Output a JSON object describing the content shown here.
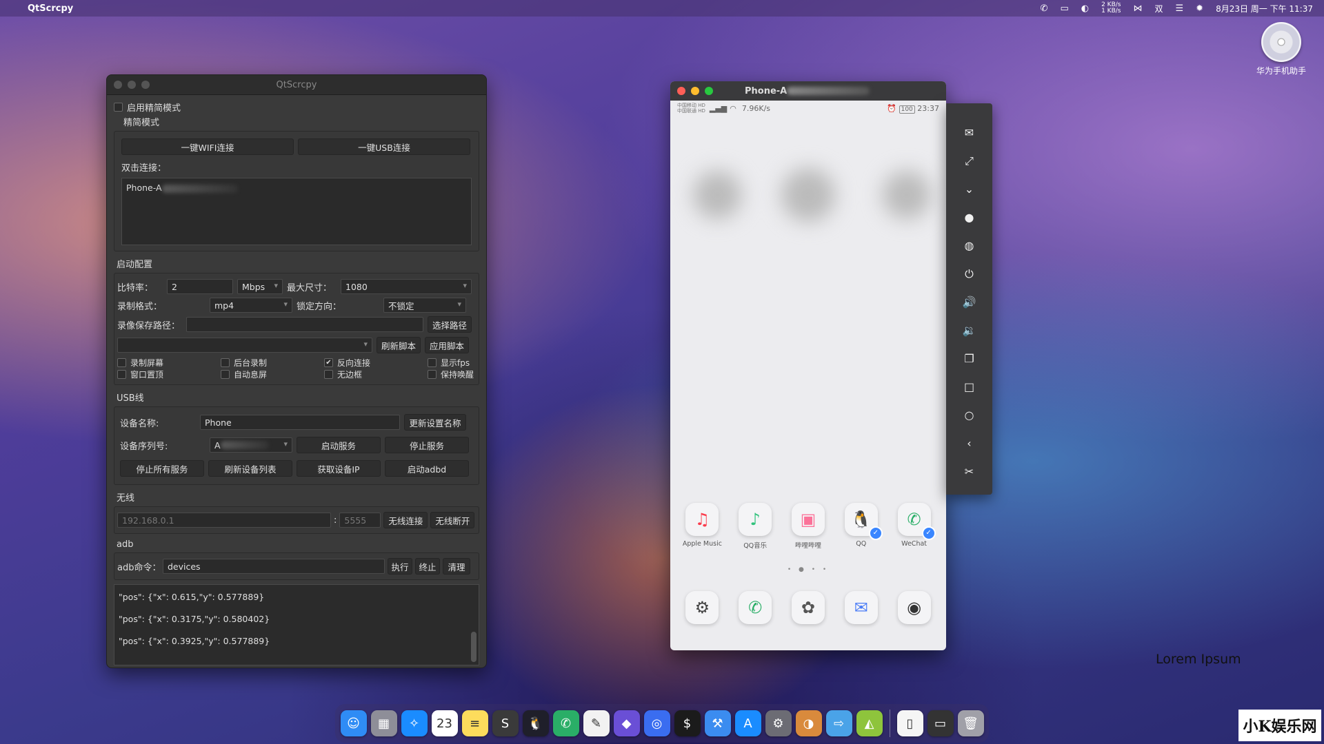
{
  "menubar": {
    "app_name": "QtScrcpy",
    "net_up": "2 KB/s",
    "net_down": "1 KB/s",
    "ime": "双",
    "datetime": "8月23日 周一 下午 11:37"
  },
  "desktop": {
    "icon_label": "华为手机助手"
  },
  "qt": {
    "title": "QtScrcpy",
    "simple_mode_checkbox": "启用精简模式",
    "simple_mode_group": "精简模式",
    "wifi_connect": "一键WIFI连接",
    "usb_connect": "一键USB连接",
    "double_click_label": "双击连接：",
    "device_list_item": "Phone-A",
    "startup_group": "启动配置",
    "bitrate_label": "比特率：",
    "bitrate_value": "2",
    "bitrate_unit": "Mbps",
    "max_size_label": "最大尺寸：",
    "max_size_value": "1080",
    "record_format_label": "录制格式：",
    "record_format_value": "mp4",
    "lock_orientation_label": "锁定方向：",
    "lock_orientation_value": "不锁定",
    "record_path_label": "录像保存路径：",
    "record_path_value": "",
    "select_path": "选择路径",
    "refresh_script": "刷新脚本",
    "apply_script": "应用脚本",
    "options": {
      "record_screen": "录制屏幕",
      "window_on_top": "窗口置顶",
      "background_record": "后台录制",
      "auto_screen_off": "自动息屏",
      "reverse_connect": "反向连接",
      "frameless": "无边框",
      "show_fps": "显示fps",
      "keep_awake": "保持唤醒"
    },
    "usb_group": "USB线",
    "device_name_label": "设备名称:",
    "device_name_value": "Phone",
    "update_name": "更新设置名称",
    "serial_label": "设备序列号:",
    "serial_value": "A",
    "start_service": "启动服务",
    "stop_service": "停止服务",
    "stop_all_services": "停止所有服务",
    "refresh_devices": "刷新设备列表",
    "get_device_ip": "获取设备IP",
    "start_adbd": "启动adbd",
    "wireless_group": "无线",
    "ip_placeholder": "192.168.0.1",
    "port_separator": ":",
    "port_placeholder": "5555",
    "wireless_connect": "无线连接",
    "wireless_disconnect": "无线断开",
    "adb_group": "adb",
    "adb_cmd_label": "adb命令：",
    "adb_cmd_value": "devices",
    "execute": "执行",
    "terminate": "终止",
    "clear": "清理",
    "log_lines": [
      "\"pos\": {\"x\": 0.615,\"y\": 0.577889}",
      "\"pos\": {\"x\": 0.3175,\"y\": 0.580402}",
      "\"pos\": {\"x\": 0.3925,\"y\": 0.577889}"
    ]
  },
  "phone": {
    "title": "Phone-A",
    "carrier1": "中国移动 HD",
    "carrier2": "中国联通 HD",
    "net_speed": "7.96K/s",
    "battery": "100",
    "time": "23:37",
    "row1": [
      {
        "name": "Apple Music",
        "icon": "music-icon",
        "glyph": "♫",
        "color": "#fa3c4c"
      },
      {
        "name": "QQ音乐",
        "icon": "qqmusic-icon",
        "glyph": "♪",
        "color": "#31c27c"
      },
      {
        "name": "哔哩哔哩",
        "icon": "bilibili-icon",
        "glyph": "▣",
        "color": "#fb7299"
      },
      {
        "name": "QQ",
        "icon": "qq-icon",
        "glyph": "🐧",
        "color": "#222"
      },
      {
        "name": "WeChat",
        "icon": "wechat-icon",
        "glyph": "✆",
        "color": "#2aae67"
      }
    ],
    "row2": [
      {
        "icon": "settings-icon",
        "glyph": "⚙",
        "color": "#444"
      },
      {
        "icon": "phone-icon",
        "glyph": "✆",
        "color": "#2aae67"
      },
      {
        "icon": "gallery-icon",
        "glyph": "✿",
        "color": "#555"
      },
      {
        "icon": "messages-icon",
        "glyph": "✉",
        "color": "#4a7cf6"
      },
      {
        "icon": "camera-icon",
        "glyph": "◉",
        "color": "#333"
      }
    ]
  },
  "toolbar": [
    {
      "name": "toolbar-wechat-icon",
      "glyph": "✉"
    },
    {
      "name": "toolbar-fullscreen-icon",
      "glyph": "⤢"
    },
    {
      "name": "toolbar-expand-notifications-icon",
      "glyph": "⌄"
    },
    {
      "name": "toolbar-touch-icon",
      "glyph": "●"
    },
    {
      "name": "toolbar-screen-off-icon",
      "glyph": "◍"
    },
    {
      "name": "toolbar-power-icon",
      "glyph": "⏻"
    },
    {
      "name": "toolbar-volume-up-icon",
      "glyph": "🔊"
    },
    {
      "name": "toolbar-volume-down-icon",
      "glyph": "🔉"
    },
    {
      "name": "toolbar-app-switch-icon",
      "glyph": "❐"
    },
    {
      "name": "toolbar-menu-icon",
      "glyph": "□"
    },
    {
      "name": "toolbar-home-icon",
      "glyph": "○"
    },
    {
      "name": "toolbar-back-icon",
      "glyph": "‹"
    },
    {
      "name": "toolbar-screenshot-icon",
      "glyph": "✂"
    }
  ],
  "watermark": {
    "lorem": "Lorem Ipsum",
    "brand": "小K娱乐网"
  },
  "dock": [
    {
      "name": "dock-finder-icon",
      "glyph": "☺",
      "color": "#2f8cf5"
    },
    {
      "name": "dock-launchpad-icon",
      "glyph": "▦",
      "color": "#8e8e98"
    },
    {
      "name": "dock-safari-icon",
      "glyph": "✧",
      "color": "#1a8cff"
    },
    {
      "name": "dock-calendar-icon",
      "glyph": "23",
      "color": "#ffffff"
    },
    {
      "name": "dock-notes-icon",
      "glyph": "≡",
      "color": "#fddc5c"
    },
    {
      "name": "dock-sublime-icon",
      "glyph": "S",
      "color": "#3a3a3a"
    },
    {
      "name": "dock-qq-icon",
      "glyph": "🐧",
      "color": "#1f1f2a"
    },
    {
      "name": "dock-wechat-icon",
      "glyph": "✆",
      "color": "#2aae67"
    },
    {
      "name": "dock-textedit-icon",
      "glyph": "✎",
      "color": "#f2f2f2"
    },
    {
      "name": "dock-obsidian-icon",
      "glyph": "◆",
      "color": "#6a4fd6"
    },
    {
      "name": "dock-browser-icon",
      "glyph": "◎",
      "color": "#3a6df0"
    },
    {
      "name": "dock-terminal-icon",
      "glyph": "$",
      "color": "#1b1b1b"
    },
    {
      "name": "dock-xcode-icon",
      "glyph": "⚒",
      "color": "#3b8cf0"
    },
    {
      "name": "dock-appstore-icon",
      "glyph": "A",
      "color": "#1a8cff"
    },
    {
      "name": "dock-system-preferences-icon",
      "glyph": "⚙",
      "color": "#6c6c74"
    },
    {
      "name": "dock-screenshot-icon",
      "glyph": "◑",
      "color": "#d98a3c"
    },
    {
      "name": "dock-migration-icon",
      "glyph": "⇨",
      "color": "#4aa3e8"
    },
    {
      "name": "dock-android-icon",
      "glyph": "◭",
      "color": "#8ec43c"
    },
    {
      "name": "dock-document-icon",
      "glyph": "▯",
      "color": "#f5f5f5"
    },
    {
      "name": "dock-window-icon",
      "glyph": "▭",
      "color": "#333"
    },
    {
      "name": "dock-trash-icon",
      "glyph": "🗑",
      "color": "#a0a0a8"
    }
  ]
}
